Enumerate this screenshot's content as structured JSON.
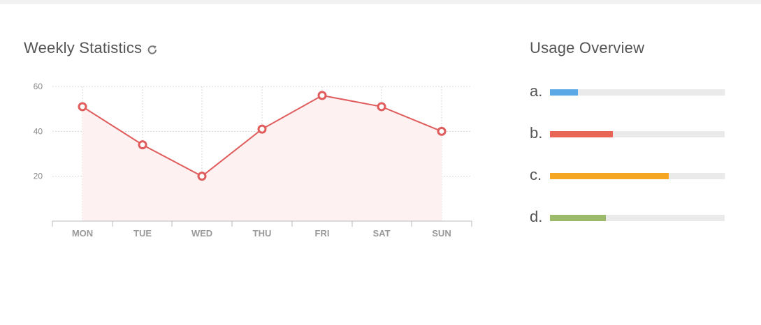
{
  "weekly": {
    "title": "Weekly Statistics",
    "refresh_icon": "refresh-icon"
  },
  "usage": {
    "title": "Usage Overview",
    "items": [
      {
        "label": "a.",
        "value": 0.16,
        "color": "#5aa9e6"
      },
      {
        "label": "b.",
        "value": 0.36,
        "color": "#e96656"
      },
      {
        "label": "c.",
        "value": 0.68,
        "color": "#f5a623"
      },
      {
        "label": "d.",
        "value": 0.32,
        "color": "#9bbb6a"
      }
    ]
  },
  "chart_data": {
    "type": "area",
    "categories": [
      "MON",
      "TUE",
      "WED",
      "THU",
      "FRI",
      "SAT",
      "SUN"
    ],
    "series": [
      {
        "values": [
          51,
          34,
          20,
          41,
          56,
          51,
          40
        ],
        "color": "#e05b5b"
      }
    ],
    "yticks": [
      20,
      40,
      60
    ],
    "ylim": [
      0,
      60
    ],
    "grid": true
  }
}
